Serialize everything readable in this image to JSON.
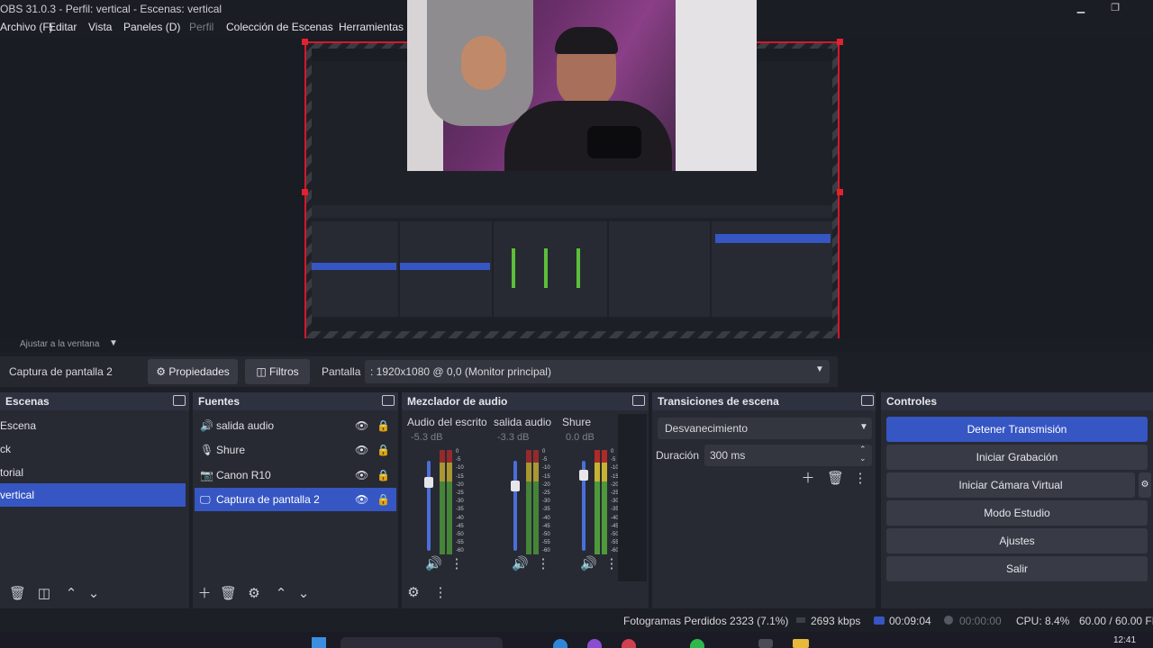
{
  "window": {
    "title": "OBS 31.0.3 - Perfil: vertical - Escenas: vertical",
    "controls": {
      "minimize": "▁",
      "maximize": "❐"
    }
  },
  "menu": [
    "Archivo (F)",
    "Editar",
    "Vista",
    "Paneles (D)",
    "Perfil",
    "Colección de Escenas",
    "Herramientas"
  ],
  "preview": {
    "zoom_label": "Ajustar a la ventana"
  },
  "context": {
    "source": "Captura de pantalla 2",
    "properties_label": "Propiedades",
    "filters_label": "Filtros",
    "display_label": "Pantalla",
    "display_value": ": 1920x1080 @ 0,0 (Monitor principal)"
  },
  "scenes": {
    "title": "Escenas",
    "items": [
      "Escena",
      "ck",
      "torial",
      "vertical"
    ],
    "selected": 3
  },
  "sources": {
    "title": "Fuentes",
    "items": [
      {
        "label": "salida audio",
        "icon": "speaker-icon"
      },
      {
        "label": "Shure",
        "icon": "microphone-icon"
      },
      {
        "label": "Canon R10",
        "icon": "camera-icon"
      },
      {
        "label": "Captura de pantalla 2",
        "icon": "monitor-icon"
      }
    ],
    "selected": 3
  },
  "mixer": {
    "title": "Mezclador de audio",
    "channels": [
      {
        "name": "Audio del escrito",
        "db": "-5.3 dB",
        "volume": 0.76
      },
      {
        "name": "salida audio",
        "db": "-3.3 dB",
        "volume": 0.72
      },
      {
        "name": "Shure",
        "db": "0.0 dB",
        "volume": 0.84
      }
    ],
    "scale": [
      "0",
      "-5",
      "-10",
      "-15",
      "-20",
      "-25",
      "-30",
      "-35",
      "-40",
      "-45",
      "-50",
      "-55",
      "-60"
    ]
  },
  "transitions": {
    "title": "Transiciones de escena",
    "selected": "Desvanecimiento",
    "duration_label": "Duración",
    "duration_value": "300 ms"
  },
  "controls": {
    "title": "Controles",
    "buttons": [
      "Detener Transmisión",
      "Iniciar Grabación",
      "Iniciar Cámara Virtual",
      "Modo Estudio",
      "Ajustes",
      "Salir"
    ]
  },
  "status": {
    "dropped": "Fotogramas Perdidos 2323 (7.1%)",
    "bitrate": "2693 kbps",
    "stream_time": "00:09:04",
    "rec_time": "00:00:00",
    "cpu": "CPU: 8.4%",
    "fps": "60.00 / 60.00 FP",
    "clock": "12:41"
  },
  "colors": {
    "accent": "#3656c4",
    "panel": "#272a33",
    "canvas_border": "#d3182b"
  }
}
